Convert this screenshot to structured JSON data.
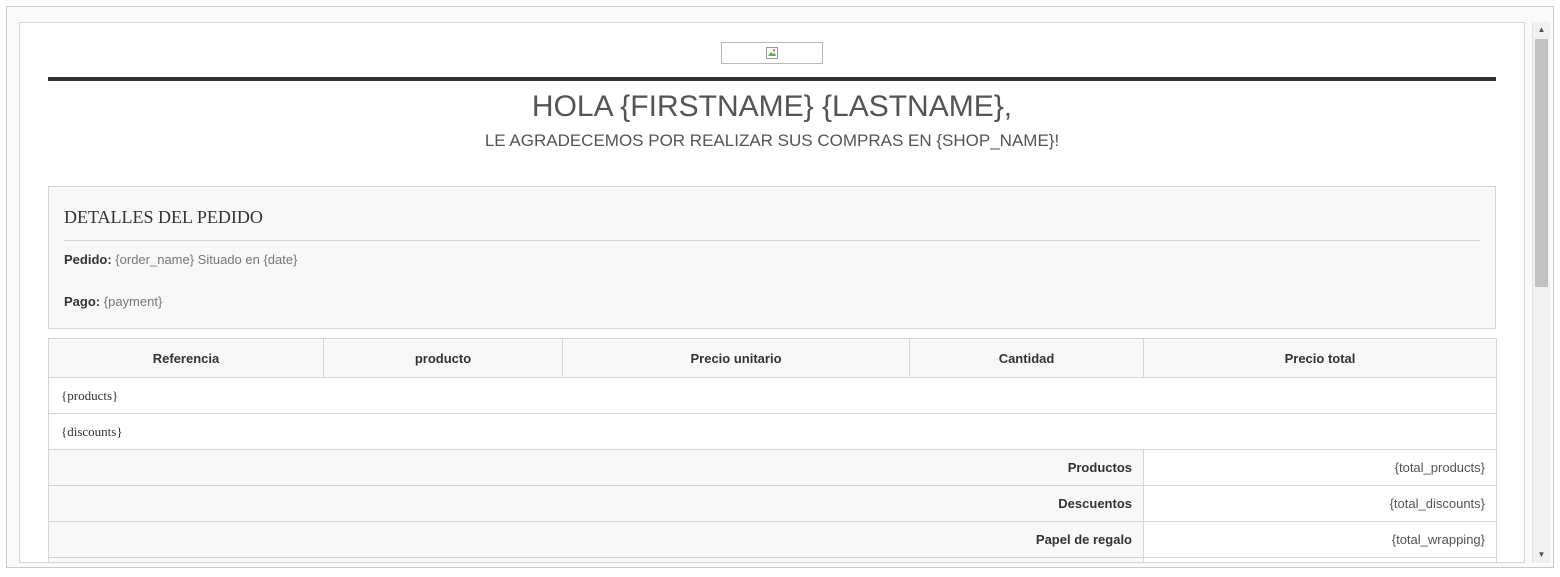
{
  "logo": {
    "alt": ""
  },
  "greeting": "HOLA {FIRSTNAME} {LASTNAME},",
  "thanks": "LE AGRADECEMOS POR REALIZAR SUS COMPRAS EN {SHOP_NAME}!",
  "details": {
    "title": "DETALLES DEL PEDIDO",
    "order_label": "Pedido:",
    "order_value": "{order_name} Situado en {date}",
    "payment_label": "Pago:",
    "payment_value": "{payment}"
  },
  "table": {
    "headers": [
      "Referencia",
      "producto",
      "Precio unitario",
      "Cantidad",
      "Precio total"
    ],
    "placeholders": [
      "{products}",
      "{discounts}"
    ],
    "totals": [
      {
        "label": "Productos",
        "value": "{total_products}"
      },
      {
        "label": "Descuentos",
        "value": "{total_discounts}"
      },
      {
        "label": "Papel de regalo",
        "value": "{total_wrapping}"
      }
    ]
  },
  "colors": {
    "text_dark": "#333333",
    "text_muted": "#777777",
    "rule": "#333333",
    "panel_bg": "#f8f8f8",
    "border": "#d6d4d4"
  }
}
